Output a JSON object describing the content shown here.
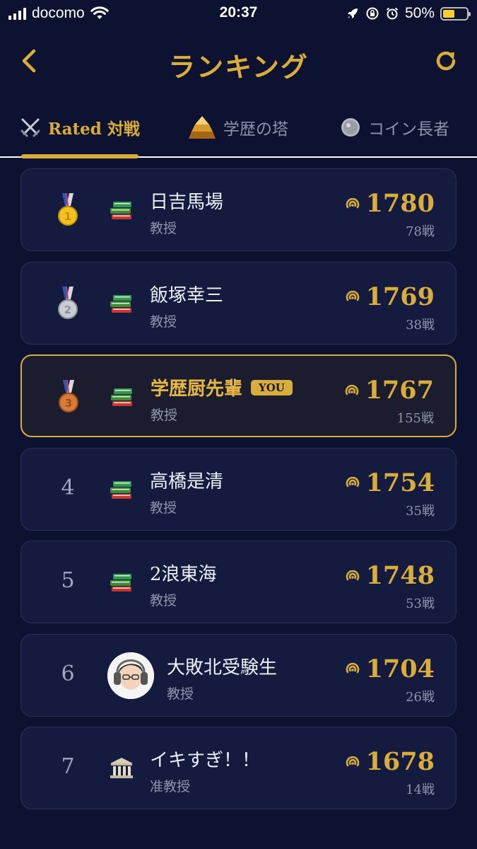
{
  "status": {
    "carrier": "docomo",
    "time": "20:37",
    "battery": "50%",
    "battery_level": 0.5
  },
  "header": {
    "title": "ランキング"
  },
  "tabs": [
    {
      "label": "Rated 対戦",
      "icon": "crossed-swords-icon",
      "active": true
    },
    {
      "label": "学歴の塔",
      "icon": "pyramid-icon",
      "active": false
    },
    {
      "label": "コイン長者",
      "icon": "coin-icon",
      "active": false
    }
  ],
  "rankings": [
    {
      "rank": "1",
      "name": "日吉馬場",
      "title": "教授",
      "rating": "1780",
      "battles": "78戦",
      "icon": "books-icon",
      "medal": "gold"
    },
    {
      "rank": "2",
      "name": "飯塚幸三",
      "title": "教授",
      "rating": "1769",
      "battles": "38戦",
      "icon": "books-icon",
      "medal": "silver"
    },
    {
      "rank": "3",
      "name": "学歴厨先輩",
      "title": "教授",
      "rating": "1767",
      "battles": "155戦",
      "icon": "books-icon",
      "medal": "bronze",
      "you": "YOU"
    },
    {
      "rank": "4",
      "name": "高橋是清",
      "title": "教授",
      "rating": "1754",
      "battles": "35戦",
      "icon": "books-icon"
    },
    {
      "rank": "5",
      "name": "2浪東海",
      "title": "教授",
      "rating": "1748",
      "battles": "53戦",
      "icon": "books-icon"
    },
    {
      "rank": "6",
      "name": "大敗北受験生",
      "title": "教授",
      "rating": "1704",
      "battles": "26戦",
      "icon": "avatar"
    },
    {
      "rank": "7",
      "name": "イキすぎ！！",
      "title": "准教授",
      "rating": "1678",
      "battles": "14戦",
      "icon": "classical-building-icon"
    }
  ],
  "colors": {
    "background": "#0c1230",
    "card": "#141b3e",
    "accent_gold": "#d9ad3c",
    "muted_text": "#8e95ae"
  }
}
